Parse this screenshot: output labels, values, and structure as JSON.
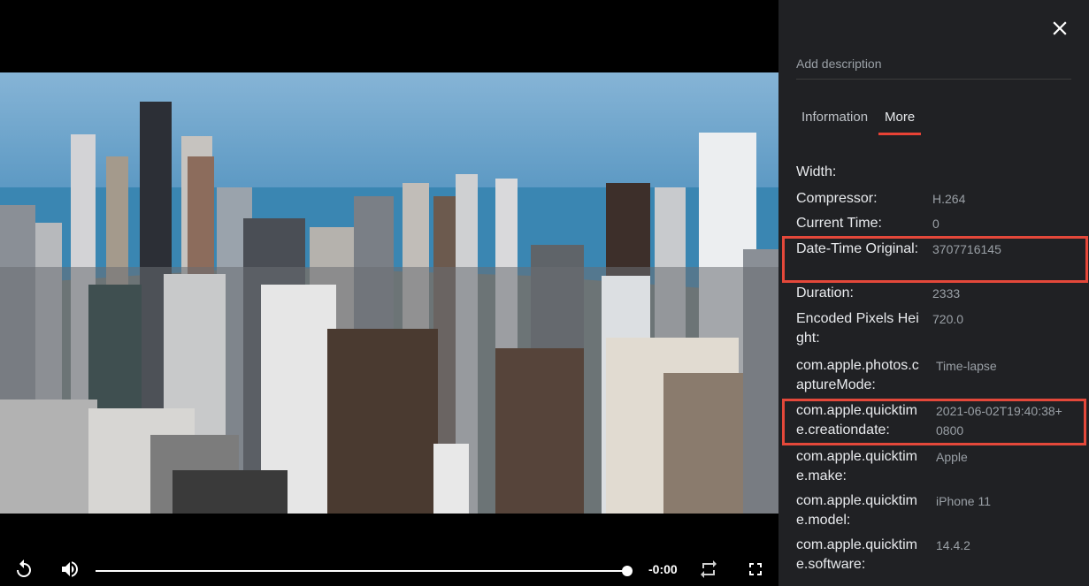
{
  "video": {
    "time_remaining": "-0:00"
  },
  "panel": {
    "description_placeholder": "Add description",
    "tabs": [
      {
        "label": "Information",
        "active": false
      },
      {
        "label": "More",
        "active": true
      }
    ],
    "properties": [
      {
        "key": "Width:",
        "value": ""
      },
      {
        "key": "Compressor:",
        "value": "H.264"
      },
      {
        "key": "Current Time:",
        "value": "0"
      },
      {
        "key": "Date-Time Original:",
        "value": "3707716145",
        "highlighted": true
      },
      {
        "key": "Duration:",
        "value": "2333"
      },
      {
        "key": "Encoded Pixels Height:",
        "value": "720.0"
      },
      {
        "key": "com.apple.photos.captureMode:",
        "value": "Time-lapse"
      },
      {
        "key": "com.apple.quicktime.creationdate:",
        "value": "2021-06-02T19:40:38+0800",
        "highlighted": true
      },
      {
        "key": "com.apple.quicktime.make:",
        "value": "Apple"
      },
      {
        "key": "com.apple.quicktime.model:",
        "value": "iPhone 11"
      },
      {
        "key": "com.apple.quicktime.software:",
        "value": "14.4.2"
      }
    ]
  },
  "colors": {
    "panel_bg": "#202124",
    "accent": "#e94235",
    "highlight_border": "#e4483a"
  },
  "icons": [
    "replay-icon",
    "volume-icon",
    "loop-icon",
    "fullscreen-icon",
    "close-icon"
  ]
}
